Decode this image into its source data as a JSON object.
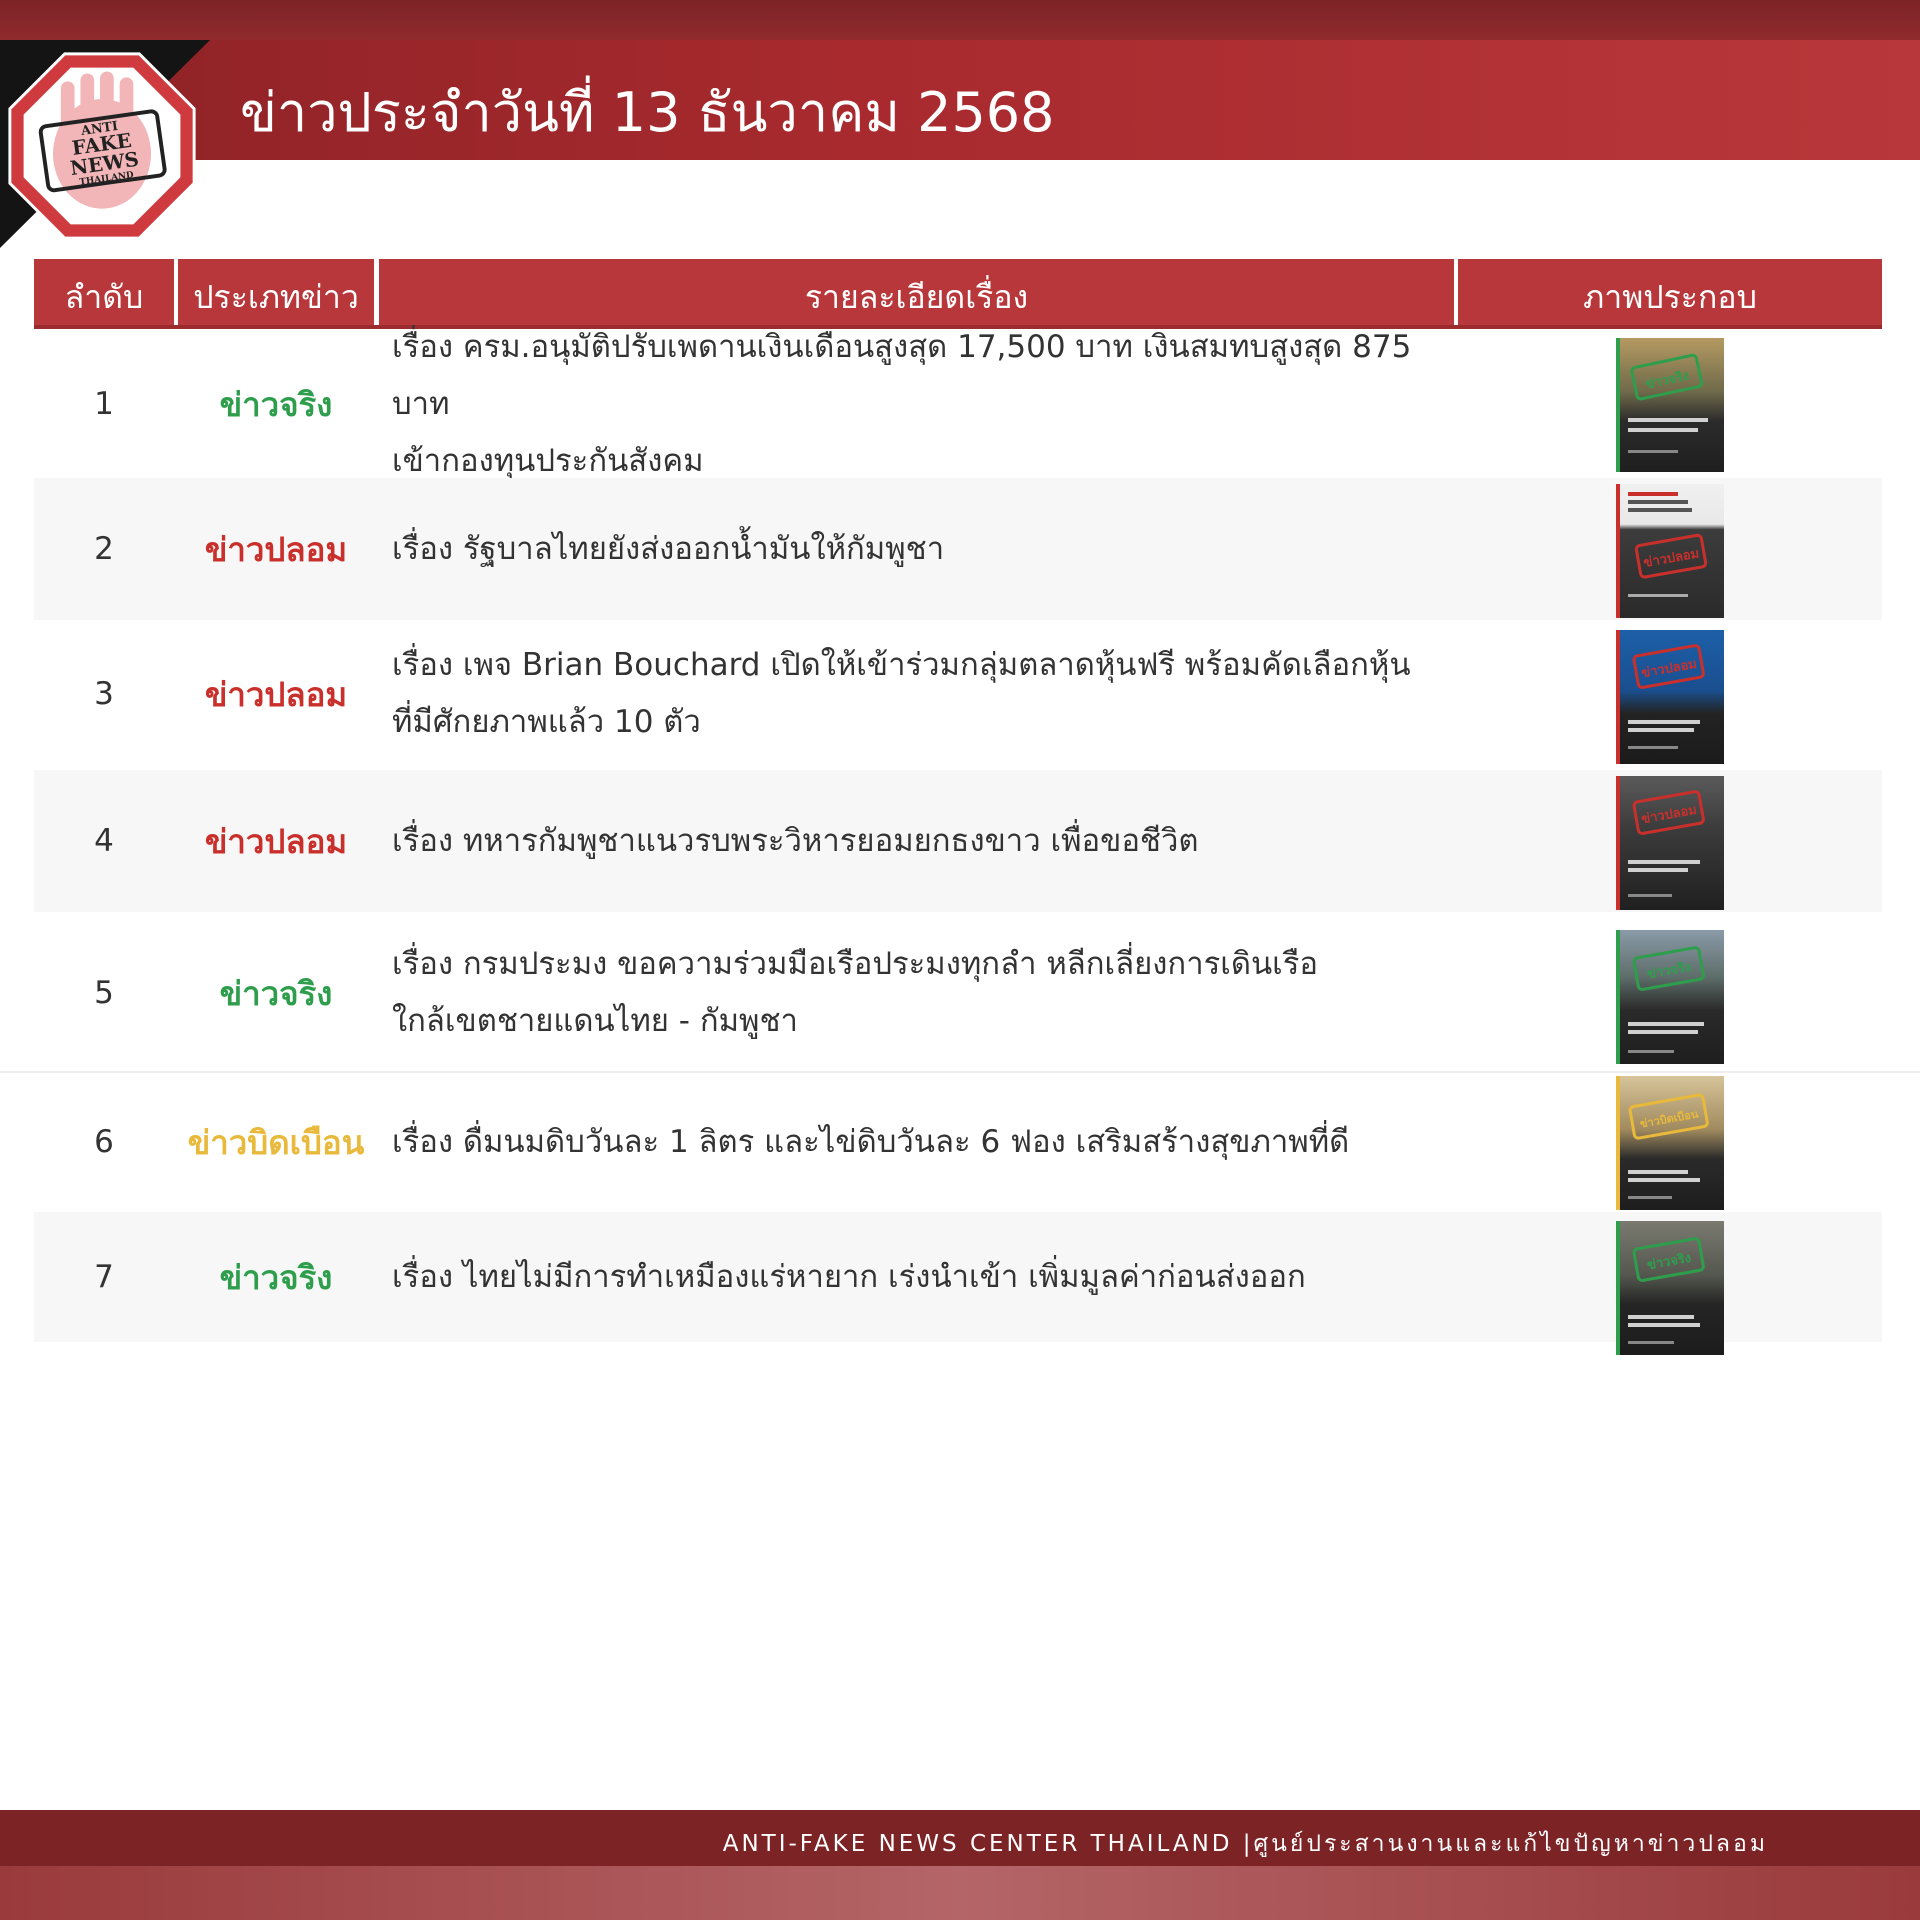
{
  "header": {
    "title": "ข่าวประจำวันที่ 13 ธันวาคม 2568",
    "logo_text": [
      "ANTI",
      "FAKE",
      "NEWS",
      "THAILAND"
    ]
  },
  "table": {
    "columns": [
      "ลำดับ",
      "ประเภทข่าว",
      "รายละเอียดเรื่อง",
      "ภาพประกอบ"
    ],
    "rows": [
      {
        "no": "1",
        "type": "ข่าวจริง",
        "type_color": "#2e9e4d",
        "line1": "เรื่อง ครม.อนุมัติปรับเพดานเงินเดือนสูงสุด 17,500 บาท เงินสมทบสูงสุด 875 บาท",
        "line2": "เข้ากองทุนประกันสังคม",
        "thumb_stamp": "ข่าวจริง",
        "thumb_color": "#2e9e4d"
      },
      {
        "no": "2",
        "type": "ข่าวปลอม",
        "type_color": "#c9302c",
        "line1": "เรื่อง รัฐบาลไทยยังส่งออกน้ำมันให้กัมพูชา",
        "line2": "",
        "thumb_stamp": "ข่าวปลอม",
        "thumb_color": "#c9302c"
      },
      {
        "no": "3",
        "type": "ข่าวปลอม",
        "type_color": "#c9302c",
        "line1": "เรื่อง เพจ Brian Bouchard เปิดให้เข้าร่วมกลุ่มตลาดหุ้นฟรี พร้อมคัดเลือกหุ้น",
        "line2": "ที่มีศักยภาพแล้ว 10 ตัว",
        "thumb_stamp": "ข่าวปลอม",
        "thumb_color": "#c9302c"
      },
      {
        "no": "4",
        "type": "ข่าวปลอม",
        "type_color": "#c9302c",
        "line1": "เรื่อง ทหารกัมพูชาแนวรบพระวิหารยอมยกธงขาว เพื่อขอชีวิต",
        "line2": "",
        "thumb_stamp": "ข่าวปลอม",
        "thumb_color": "#c9302c"
      },
      {
        "no": "5",
        "type": "ข่าวจริง",
        "type_color": "#2e9e4d",
        "line1": "เรื่อง กรมประมง ขอความร่วมมือเรือประมงทุกลำ หลีกเลี่ยงการเดินเรือ",
        "line2": "ใกล้เขตชายแดนไทย - กัมพูชา",
        "thumb_stamp": "ข่าวจริง",
        "thumb_color": "#2e9e4d"
      },
      {
        "no": "6",
        "type": "ข่าวบิดเบือน",
        "type_color": "#e8b93a",
        "line1": "เรื่อง ดื่มนมดิบวันละ 1 ลิตร และไข่ดิบวันละ 6 ฟอง เสริมสร้างสุขภาพที่ดี",
        "line2": "",
        "thumb_stamp": "ข่าวบิดเบือน",
        "thumb_color": "#e8b93a"
      },
      {
        "no": "7",
        "type": "ข่าวจริง",
        "type_color": "#2e9e4d",
        "line1": "เรื่อง ไทยไม่มีการทำเหมืองแร่หายาก เร่งนำเข้า เพิ่มมูลค่าก่อนส่งออก",
        "line2": "",
        "thumb_stamp": "ข่าวจริง",
        "thumb_color": "#2e9e4d"
      }
    ]
  },
  "footer": {
    "text": "ANTI-FAKE NEWS CENTER THAILAND |ศูนย์ประสานงานและแก้ไขปัญหาข่าวปลอม"
  }
}
